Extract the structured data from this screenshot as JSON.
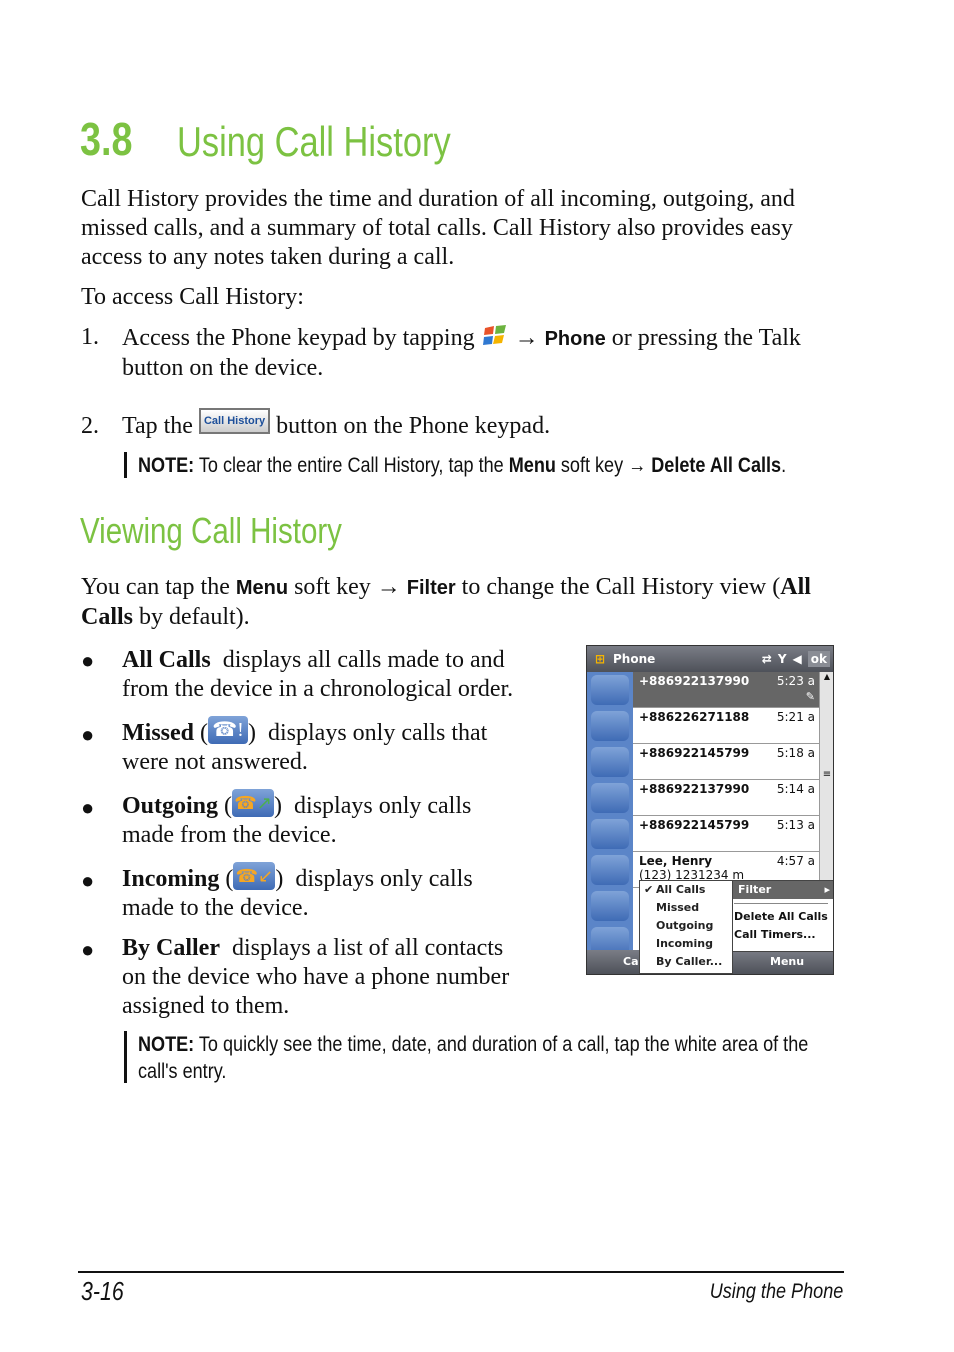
{
  "heading": {
    "number": "3.8",
    "title": "Using Call History"
  },
  "intro": "Call History provides the time and duration of all incoming, outgoing, and missed calls, and a summary of total calls. Call History also provides easy access to any notes taken during a call.",
  "access_label": "To access Call History:",
  "steps": [
    {
      "num": "1.",
      "before": "Access the Phone keypad by tapping",
      "arrow": "→",
      "bold": "Phone",
      "after": "or pressing the Talk button on the device."
    },
    {
      "num": "2.",
      "before": "Tap the",
      "button_label": "Call History",
      "after": "button on the Phone keypad."
    }
  ],
  "note1": {
    "label": "NOTE:",
    "text1": "To clear the entire Call History, tap the",
    "menu": "Menu",
    "text2": "soft key",
    "arrow": "→",
    "action": "Delete All Calls",
    "end": "."
  },
  "subheading": "Viewing Call History",
  "view_text": {
    "t1": "You can tap the",
    "menu": "Menu",
    "t2": "soft key",
    "arrow": "→",
    "filter": "Filter",
    "t3": "to change the Call History view (",
    "all": "All Calls",
    "t4": "by default)."
  },
  "bullets": [
    {
      "term": "All Calls",
      "line1": "displays all calls made to and",
      "line2": "from the device in a chronological order.",
      "icon": null
    },
    {
      "term": "Missed",
      "line1": "displays only calls that",
      "line2": "were not answered.",
      "icon": "missed-call-icon"
    },
    {
      "term": "Outgoing",
      "line1": "displays only calls",
      "line2": "made from the device.",
      "icon": "outgoing-call-icon"
    },
    {
      "term": "Incoming",
      "line1": "displays only calls",
      "line2": "made to the device.",
      "icon": "incoming-call-icon"
    },
    {
      "term": "By Caller",
      "line1": "displays a list of all contacts",
      "line2": "on the device who have a phone number",
      "line3": "assigned to them.",
      "icon": null
    }
  ],
  "note2": {
    "label": "NOTE:",
    "text": "To quickly see the time, date, and duration of a call, tap the white area of the call's entry."
  },
  "phone": {
    "title": "Phone",
    "ok": "ok",
    "calls": [
      {
        "name": "+886922137990",
        "time": "5:23 a",
        "type": "incoming"
      },
      {
        "name": "+886226271188",
        "time": "5:21 a",
        "type": "outgoing"
      },
      {
        "name": "+886922145799",
        "time": "5:18 a",
        "type": "incoming"
      },
      {
        "name": "+886922137990",
        "time": "5:14 a",
        "type": "incoming"
      },
      {
        "name": "+886922145799",
        "time": "5:13 a",
        "type": "incoming"
      },
      {
        "name": "Lee, Henry",
        "sub": "(123) 1231234 m",
        "time": "4:57 a",
        "type": "outgoing"
      }
    ],
    "submenu": [
      "All Calls",
      "Missed",
      "Outgoing",
      "Incoming",
      "By Caller..."
    ],
    "menu": [
      "Filter",
      "Delete All Calls",
      "Call Timers..."
    ],
    "softkey_left": "Cal",
    "softkey_right": "Menu"
  },
  "footer": {
    "page": "3-16",
    "section": "Using the Phone"
  },
  "colors": {
    "accent": "#7cc242"
  }
}
